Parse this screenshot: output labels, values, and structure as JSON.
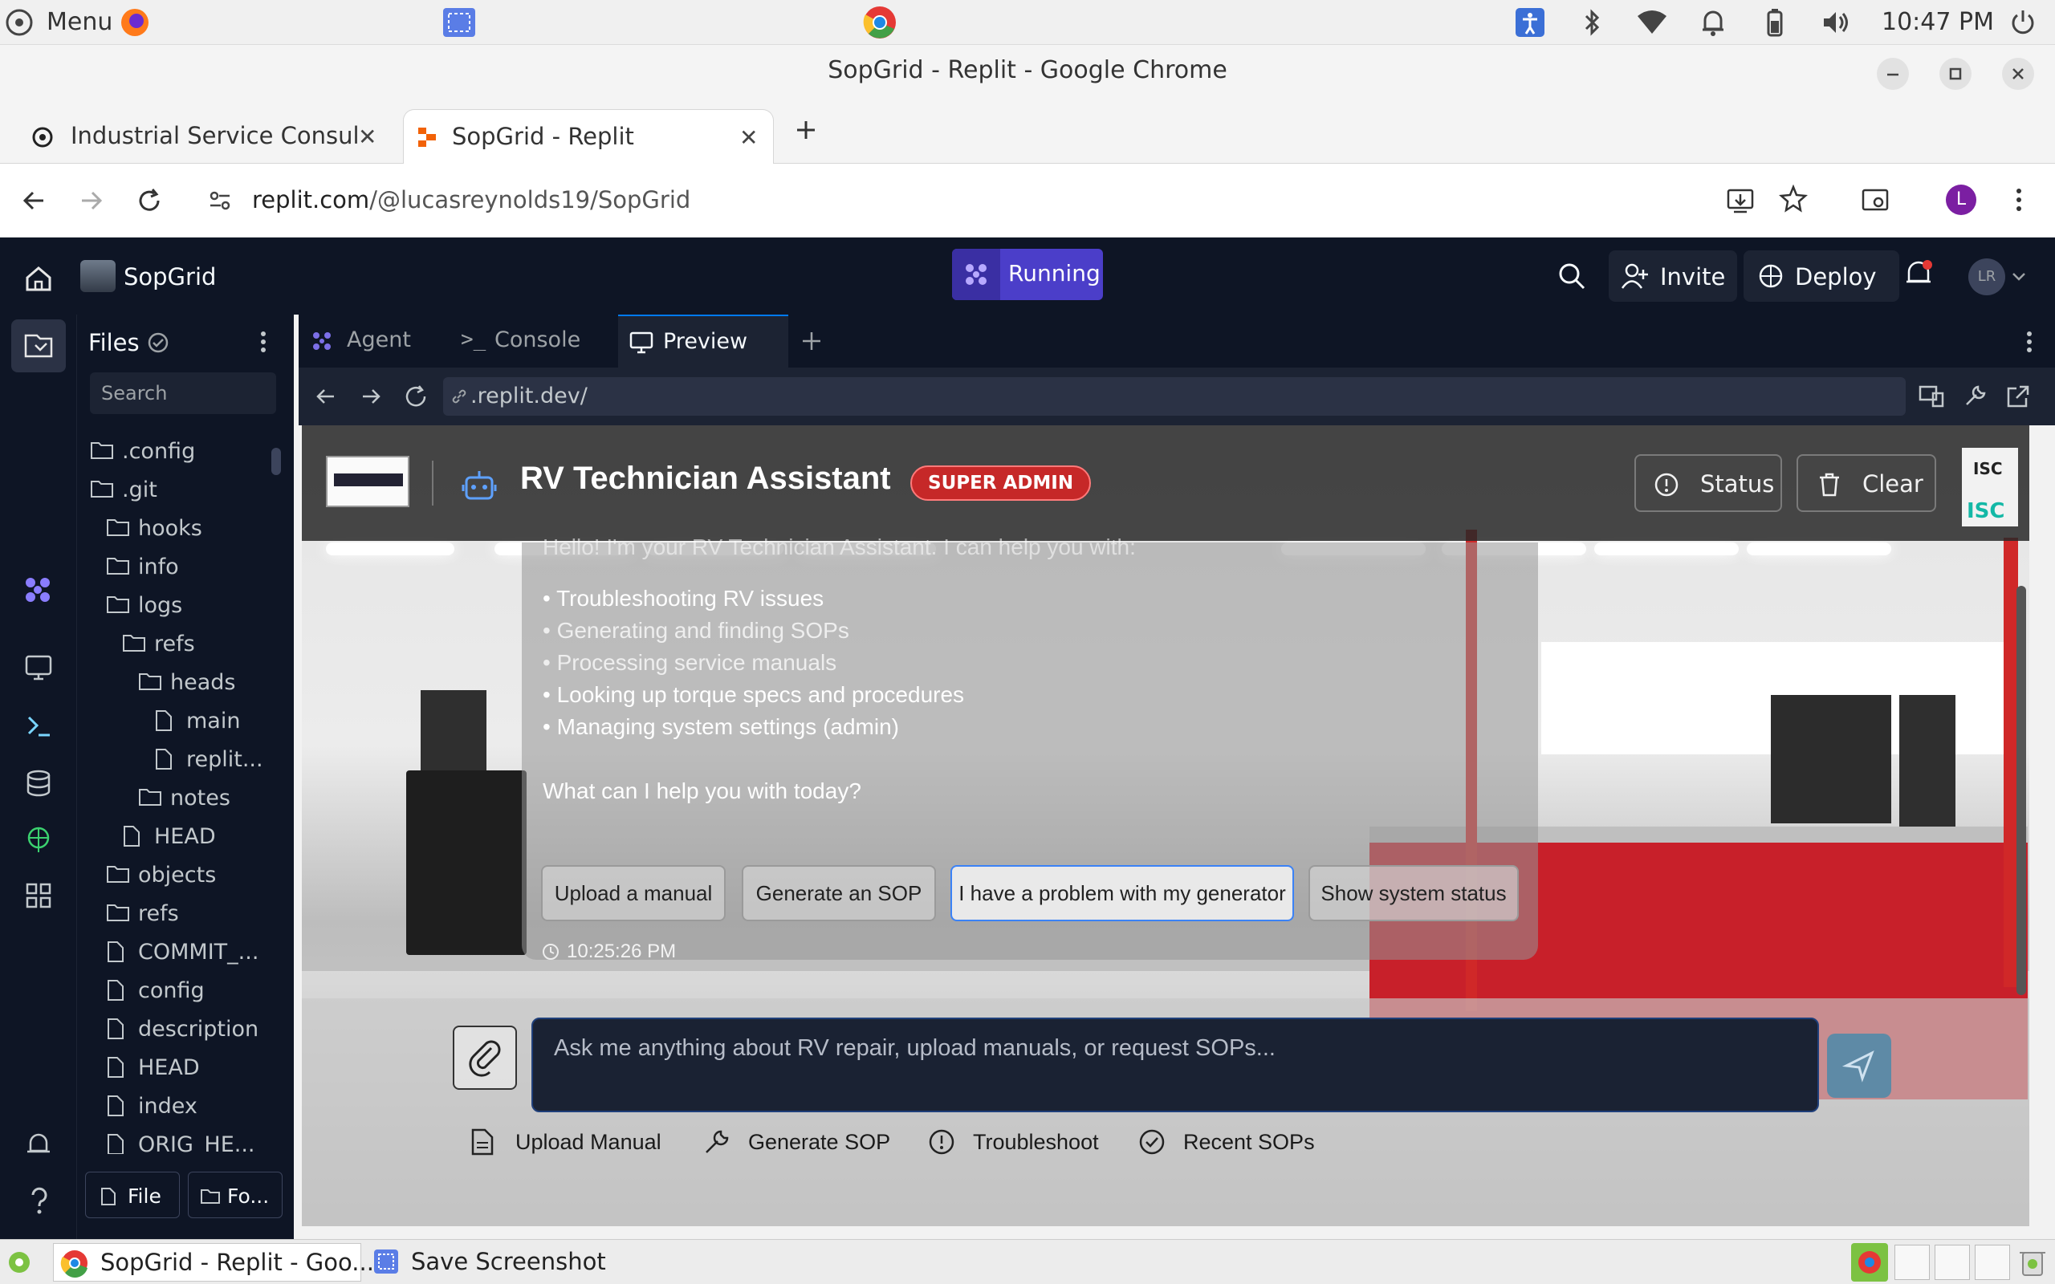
{
  "os": {
    "menu_label": "Menu",
    "clock": "10:47 PM"
  },
  "browser": {
    "window_title": "SopGrid - Replit - Google Chrome",
    "tabs": [
      {
        "label": "Industrial Service Consul",
        "active": false
      },
      {
        "label": "SopGrid - Replit",
        "active": true
      }
    ],
    "url_host": "replit.com",
    "url_path": "/@lucasreynolds19/SopGrid",
    "profile_initial": "L"
  },
  "replit": {
    "project_name": "SopGrid",
    "run_status": "Running",
    "invite_label": "Invite",
    "deploy_label": "Deploy",
    "avatar_initials": "LR",
    "files_title": "Files",
    "search_placeholder": "Search",
    "file_tree": [
      {
        "name": ".config",
        "type": "folder",
        "depth": 0
      },
      {
        "name": ".git",
        "type": "folder-open",
        "depth": 0
      },
      {
        "name": "hooks",
        "type": "folder",
        "depth": 1
      },
      {
        "name": "info",
        "type": "folder",
        "depth": 1
      },
      {
        "name": "logs",
        "type": "folder-open",
        "depth": 1
      },
      {
        "name": "refs",
        "type": "folder-open",
        "depth": 2
      },
      {
        "name": "heads",
        "type": "folder-open",
        "depth": 3
      },
      {
        "name": "main",
        "type": "file",
        "depth": 4
      },
      {
        "name": "replit...",
        "type": "file",
        "depth": 4
      },
      {
        "name": "notes",
        "type": "folder",
        "depth": 3
      },
      {
        "name": "HEAD",
        "type": "file",
        "depth": 2
      },
      {
        "name": "objects",
        "type": "folder",
        "depth": 1
      },
      {
        "name": "refs",
        "type": "folder",
        "depth": 1
      },
      {
        "name": "COMMIT_...",
        "type": "file",
        "depth": 1
      },
      {
        "name": "config",
        "type": "file",
        "depth": 1
      },
      {
        "name": "description",
        "type": "file",
        "depth": 1
      },
      {
        "name": "HEAD",
        "type": "file",
        "depth": 1
      },
      {
        "name": "index",
        "type": "file",
        "depth": 1
      },
      {
        "name": "ORIG_HE...",
        "type": "file",
        "depth": 1
      }
    ],
    "new_file_label": "File",
    "new_folder_label": "Fo...",
    "workspace_tabs": [
      {
        "label": "Agent",
        "active": false
      },
      {
        "label": "Console",
        "active": false
      },
      {
        "label": "Preview",
        "active": true
      }
    ],
    "preview_url": ".replit.dev/"
  },
  "app": {
    "title": "RV Technician Assistant",
    "role_badge": "SUPER ADMIN",
    "status_label": "Status",
    "clear_label": "Clear",
    "logo_text_top": "ISC",
    "logo_text_bottom": "ISC",
    "greeting_partial": "Hello! I'm your RV Technician Assistant. I can help you with:",
    "capabilities": [
      "• Troubleshooting RV issues",
      "• Generating and finding SOPs",
      "• Processing service manuals",
      "• Looking up torque specs and procedures",
      "• Managing system settings (admin)"
    ],
    "prompt": "What can I help you with today?",
    "suggestions": [
      "Upload a manual",
      "Generate an SOP",
      "I have a problem with my generator",
      "Show system status"
    ],
    "timestamp": "10:25:26 PM",
    "input_placeholder": "Ask me anything about RV repair, upload manuals, or request SOPs...",
    "quick_actions": [
      "Upload Manual",
      "Generate SOP",
      "Troubleshoot",
      "Recent SOPs"
    ]
  },
  "taskbar": {
    "items": [
      "SopGrid - Replit - Goo...",
      "Save Screenshot"
    ]
  },
  "colors": {
    "replit_bg": "#0e1525",
    "running_purple": "#4b3ec9",
    "badge_red": "#c62828",
    "input_bg": "#1a2233"
  }
}
